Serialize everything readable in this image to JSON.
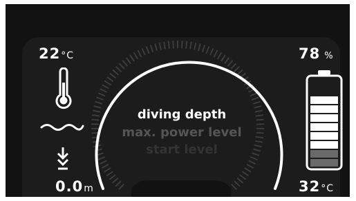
{
  "left": {
    "temperature_value": "22",
    "temperature_unit": "°C",
    "depth_value": "0.0",
    "depth_unit": "m",
    "icons": [
      "thermometer-icon",
      "water-wave-icon",
      "dive-down-arrow-icon"
    ]
  },
  "center": {
    "menu": [
      {
        "label": "diving depth",
        "state": "selected"
      },
      {
        "label": "max. power level",
        "state": "next"
      },
      {
        "label": "start level",
        "state": "faded"
      }
    ]
  },
  "right": {
    "battery_value": "78",
    "battery_unit": "%",
    "battery_level": 0.78,
    "water_temperature_value": "32",
    "water_temperature_unit": "°C",
    "icons": [
      "battery-icon"
    ]
  },
  "colors": {
    "background": "#121212",
    "panel": "#1c1c1c",
    "foreground": "#ffffff",
    "dim_text": "#555555",
    "faded_text": "#333333"
  }
}
